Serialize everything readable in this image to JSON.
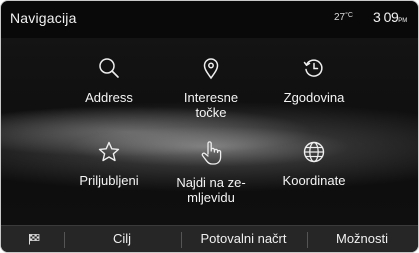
{
  "header": {
    "title": "Navigacija",
    "temperature": "27",
    "temperature_unit": "°C",
    "time": "3 09",
    "time_suffix": "PM"
  },
  "menu": {
    "items": [
      {
        "label": "Address",
        "icon": "search-icon"
      },
      {
        "label": "Interesne točke",
        "icon": "map-pin-icon"
      },
      {
        "label": "Zgodovina",
        "icon": "history-icon"
      },
      {
        "label": "Priljubljeni",
        "icon": "star-icon"
      },
      {
        "label": "Najdi na zemljevidu",
        "label_display": "Najdi na ze-\nmljevidu",
        "icon": "hand-pointer-icon"
      },
      {
        "label": "Koordinate",
        "icon": "globe-icon"
      }
    ]
  },
  "bottom_bar": {
    "flag_icon": "checkered-flag-icon",
    "tabs": [
      "Cilj",
      "Potovalni načrt",
      "Možnosti"
    ]
  }
}
